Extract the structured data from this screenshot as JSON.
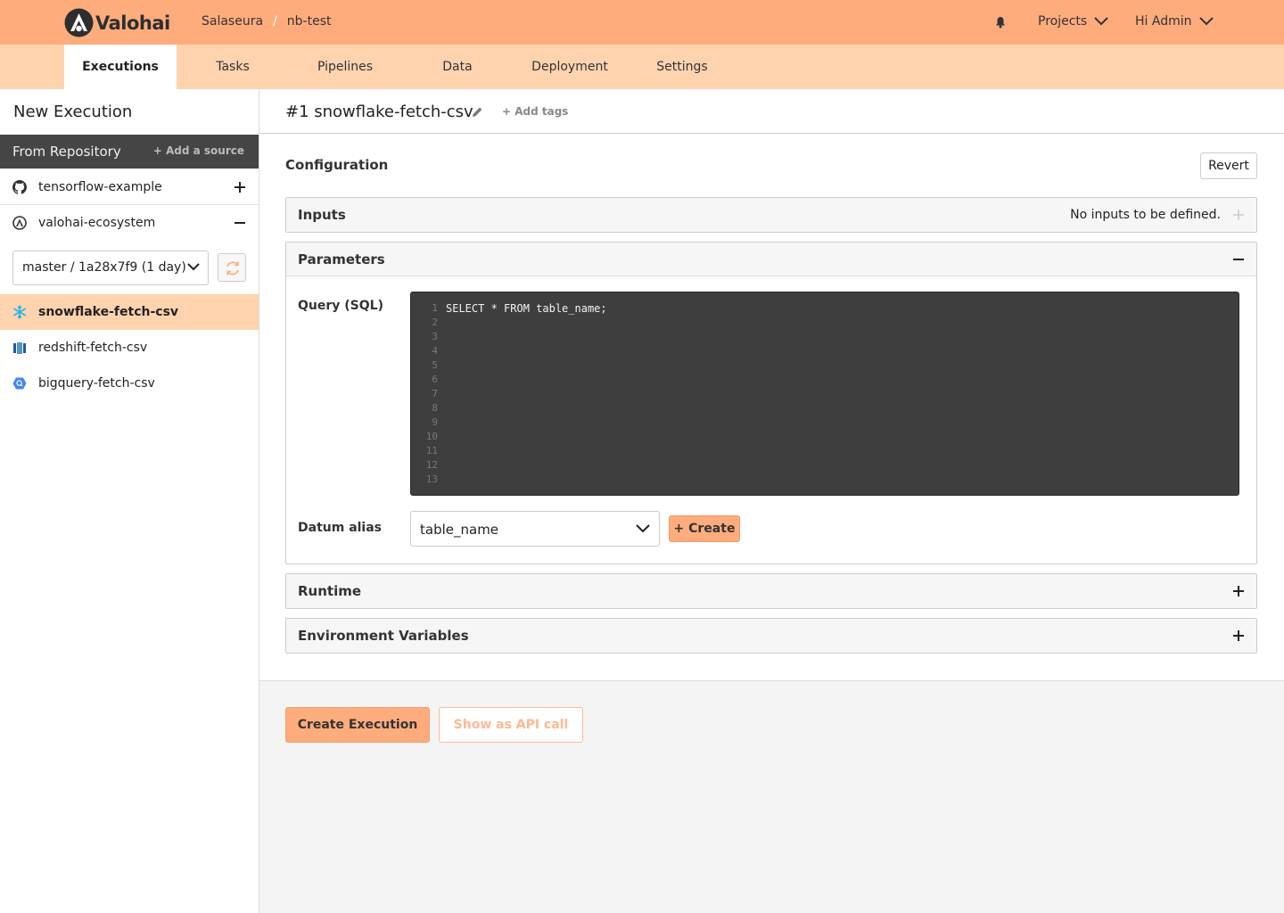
{
  "app": {
    "name": "Valohai"
  },
  "breadcrumb": {
    "org": "Salaseura",
    "separator": "/",
    "project": "nb-test"
  },
  "header": {
    "projects_label": "Projects",
    "user_label": "Hi Admin"
  },
  "tabs": [
    {
      "label": "Executions",
      "active": true
    },
    {
      "label": "Tasks",
      "active": false
    },
    {
      "label": "Pipelines",
      "active": false
    },
    {
      "label": "Data",
      "active": false
    },
    {
      "label": "Deployment",
      "active": false
    },
    {
      "label": "Settings",
      "active": false
    }
  ],
  "sidebar": {
    "title": "New Execution",
    "source_header": "From Repository",
    "add_source": "+ Add a source",
    "repos": [
      {
        "name": "tensorflow-example",
        "icon": "github-icon",
        "expanded": false
      },
      {
        "name": "valohai-ecosystem",
        "icon": "valohai-icon",
        "expanded": true
      }
    ],
    "branch": "master / 1a28x7f9 (1 day)",
    "steps": [
      {
        "name": "snowflake-fetch-csv",
        "icon": "snowflake-icon",
        "active": true
      },
      {
        "name": "redshift-fetch-csv",
        "icon": "redshift-icon",
        "active": false
      },
      {
        "name": "bigquery-fetch-csv",
        "icon": "bigquery-icon",
        "active": false
      }
    ]
  },
  "main": {
    "title": "#1 snowflake-fetch-csv",
    "add_tags": "+ Add tags",
    "configuration_title": "Configuration",
    "revert_label": "Revert",
    "inputs": {
      "title": "Inputs",
      "note": "No inputs to be defined."
    },
    "parameters": {
      "title": "Parameters",
      "query_label": "Query (SQL)",
      "query_lines": [
        "SELECT * FROM table_name;",
        "",
        "",
        "",
        "",
        "",
        "",
        "",
        "",
        "",
        "",
        "",
        ""
      ],
      "line_numbers": [
        "1",
        "2",
        "3",
        "4",
        "5",
        "6",
        "7",
        "8",
        "9",
        "10",
        "11",
        "12",
        "13"
      ],
      "datum_label": "Datum alias",
      "datum_value": "table_name",
      "create_label": "+ Create"
    },
    "runtime": {
      "title": "Runtime"
    },
    "env_vars": {
      "title": "Environment Variables"
    }
  },
  "footer": {
    "create_execution": "Create Execution",
    "show_api": "Show as API call"
  },
  "colors": {
    "topbar": "#ffac7d",
    "tabbar": "#ffd3ae",
    "accent": "#ffac7d",
    "editor_bg": "#3e3e3e",
    "source_header_bg": "#454545"
  }
}
